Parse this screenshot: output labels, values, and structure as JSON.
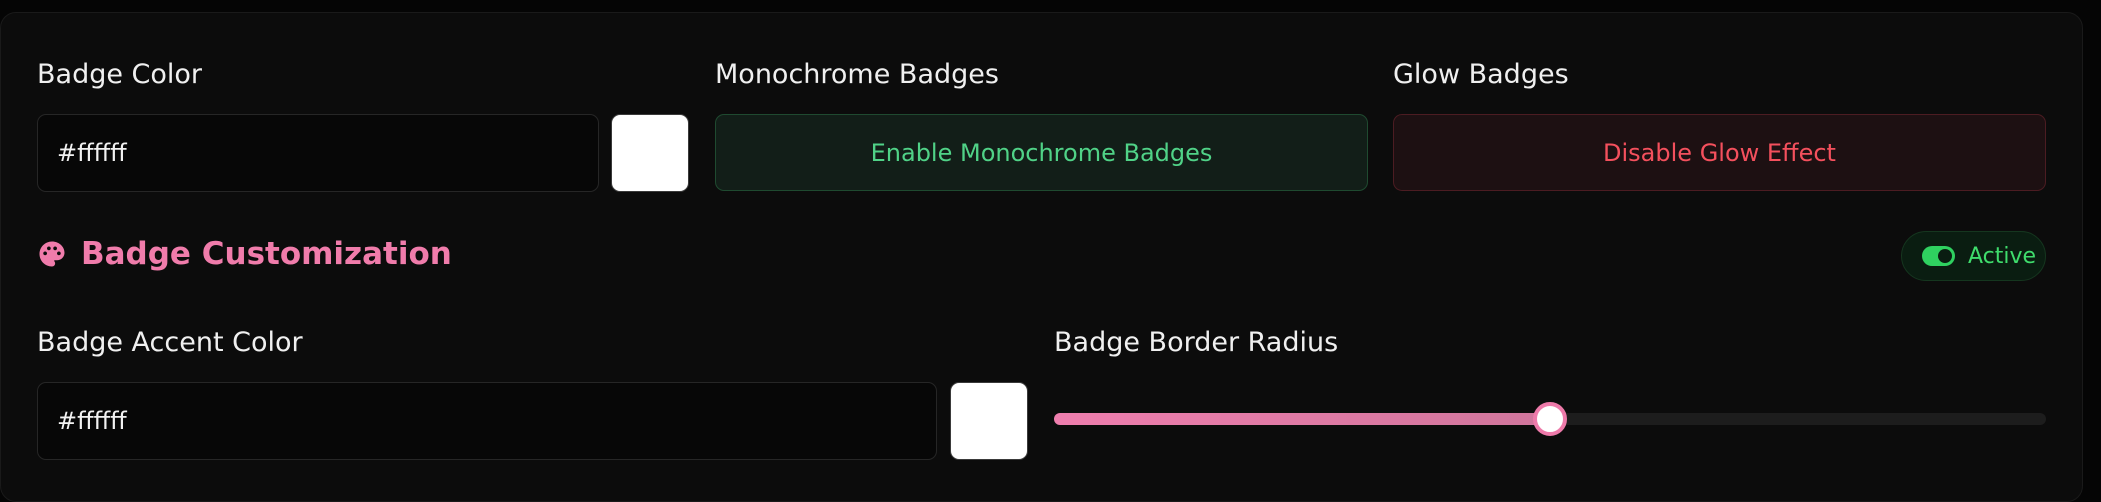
{
  "badge_color": {
    "label": "Badge Color",
    "value": "#ffffff",
    "swatch_color": "#ffffff"
  },
  "monochrome": {
    "label": "Monochrome Badges",
    "button_label": "Enable Monochrome Badges"
  },
  "glow": {
    "label": "Glow Badges",
    "button_label": "Disable Glow Effect"
  },
  "customization": {
    "title": "Badge Customization",
    "icon": "palette-icon",
    "status_label": "Active",
    "status_on": true
  },
  "accent_color": {
    "label": "Badge Accent Color",
    "value": "#ffffff",
    "swatch_color": "#ffffff"
  },
  "border_radius": {
    "label": "Badge Border Radius",
    "level": 0.5
  },
  "colors": {
    "accent": "#f07cab",
    "success": "#50d287",
    "danger": "#f4505d",
    "active": "#3fdc6c"
  }
}
